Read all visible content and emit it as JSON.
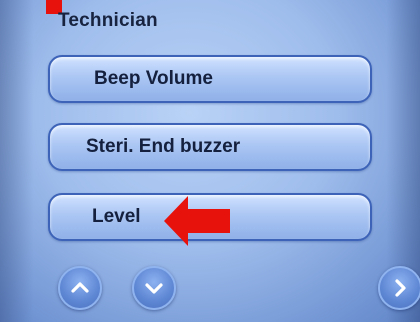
{
  "header": {
    "title": "Technician"
  },
  "menu": {
    "items": [
      {
        "label": "Beep Volume"
      },
      {
        "label": "Steri. End buzzer"
      },
      {
        "label": "Level"
      }
    ]
  },
  "nav": {
    "up_icon": "chevron-up-icon",
    "down_icon": "chevron-down-icon",
    "next_icon": "chevron-right-icon"
  },
  "colors": {
    "screen_bg": "#a9c5f3",
    "button_border": "#3d63b8",
    "annotation_red": "#e8120c"
  }
}
